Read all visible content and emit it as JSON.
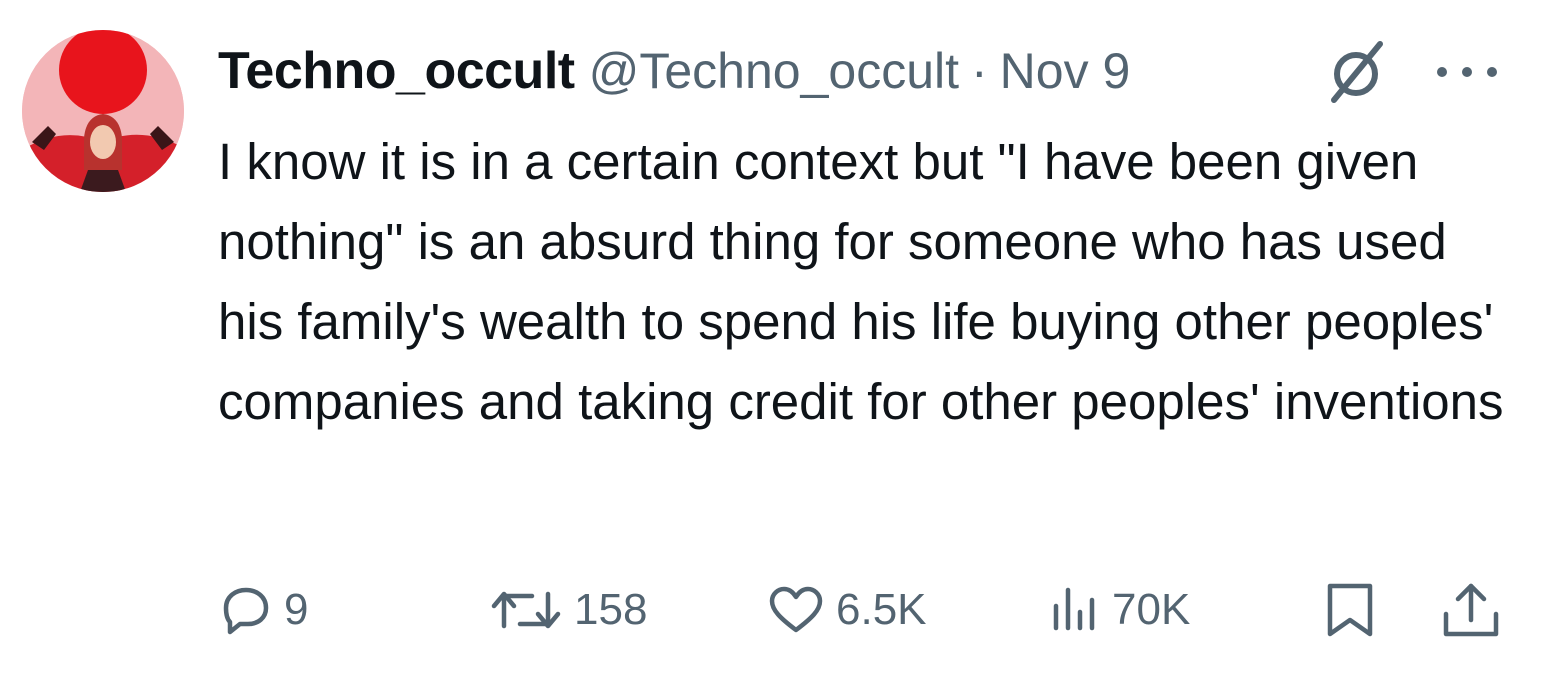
{
  "author": {
    "display_name": "Techno_occult",
    "handle": "@Techno_occult",
    "separator": "·",
    "date": "Nov 9"
  },
  "tweet": {
    "text": "I know it is in a certain context but \"I have been given nothing\" is an absurd thing for someone who has used his family's wealth to spend his life buying other peoples' companies and taking credit for other peoples' inventions"
  },
  "actions": {
    "replies": "9",
    "retweets": "158",
    "likes": "6.5K",
    "views": "70K"
  },
  "icons": {
    "header": [
      "grok-icon",
      "more-options-icon"
    ],
    "actions": [
      "reply-icon",
      "retweet-icon",
      "like-icon",
      "views-icon",
      "bookmark-icon",
      "share-icon"
    ]
  },
  "colors": {
    "text_primary": "#0f1419",
    "text_secondary": "#536471",
    "background": "#ffffff",
    "avatar_sun": "#e8141c",
    "avatar_bg": "#f3b5b8"
  }
}
